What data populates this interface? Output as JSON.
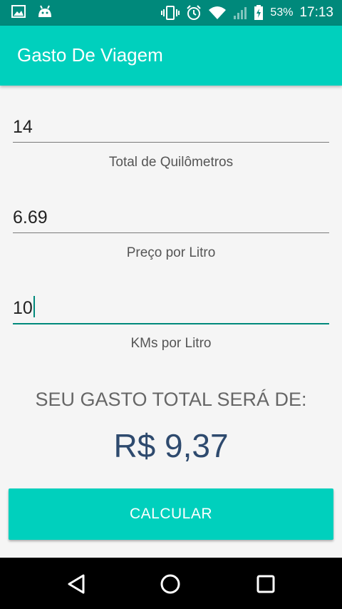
{
  "status_bar": {
    "battery_percent": "53%",
    "time": "17:13",
    "icons": [
      "image-icon",
      "android-icon",
      "vibrate-icon",
      "alarm-icon",
      "wifi-icon",
      "signal-icon",
      "battery-icon"
    ]
  },
  "app": {
    "title": "Gasto De Viagem"
  },
  "form": {
    "km_total": {
      "value": "14",
      "caption": "Total de Quilômetros"
    },
    "price_per_liter": {
      "value": "6.69",
      "caption": "Preço por Litro"
    },
    "km_per_liter": {
      "value": "10",
      "caption": "KMs por Litro"
    }
  },
  "result": {
    "label": "SEU GASTO TOTAL SERÁ DE:",
    "value": "R$ 9,37"
  },
  "actions": {
    "calculate_label": "CALCULAR"
  },
  "colors": {
    "status_bar": "#00897b",
    "app_bar": "#00d0bd",
    "accent": "#00897b",
    "result_value": "#2e4a6e"
  },
  "navigation": {
    "icons": [
      "back-icon",
      "home-icon",
      "recents-icon"
    ]
  }
}
